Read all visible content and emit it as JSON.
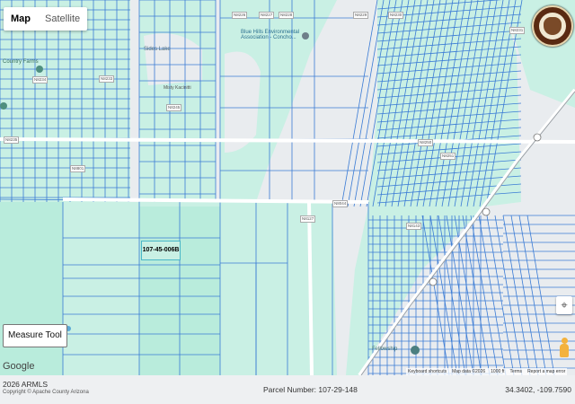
{
  "map_type": {
    "map": "Map",
    "satellite": "Satellite",
    "active": "Map"
  },
  "parcel_selected": "107-45-006B",
  "controls": {
    "measure_tool": "Measure Tool",
    "locate_symbol": "⌖"
  },
  "branding": {
    "google": "Google"
  },
  "poi": {
    "blue_hills_line1": "Blue Hills Environmental",
    "blue_hills_line2": "Association - Concho...",
    "sides_lake": "Sides Lake",
    "country_farms": "Country Farms",
    "misty_lake_label": "Misty Kacinitti",
    "fellowship": "Fellowship"
  },
  "road_labels": [
    "N8226",
    "N8227",
    "N8228",
    "N8229",
    "N8230",
    "N8231",
    "N8233",
    "N8234",
    "N8235",
    "N8245",
    "N8250",
    "N8251",
    "N8801",
    "N8044",
    "N8127",
    "N8143"
  ],
  "attribution": {
    "shortcuts": "Keyboard shortcuts",
    "map_data": "Map data ©2026",
    "scale": "1000 ft",
    "terms": "Terms",
    "report": "Report a map error"
  },
  "footer": {
    "copyright_year": "2026 ARMLS",
    "copyright_line": "Copyright © Apache County Arizona",
    "parcel_number": "Parcel Number: 107-29-148",
    "coordinates": "34.3402, -109.7590"
  },
  "colors": {
    "teal_fill": "#c9f0e4",
    "parcel_line": "#3a7bd5",
    "map_gray": "#e9ecef",
    "road_white": "#ffffff"
  }
}
